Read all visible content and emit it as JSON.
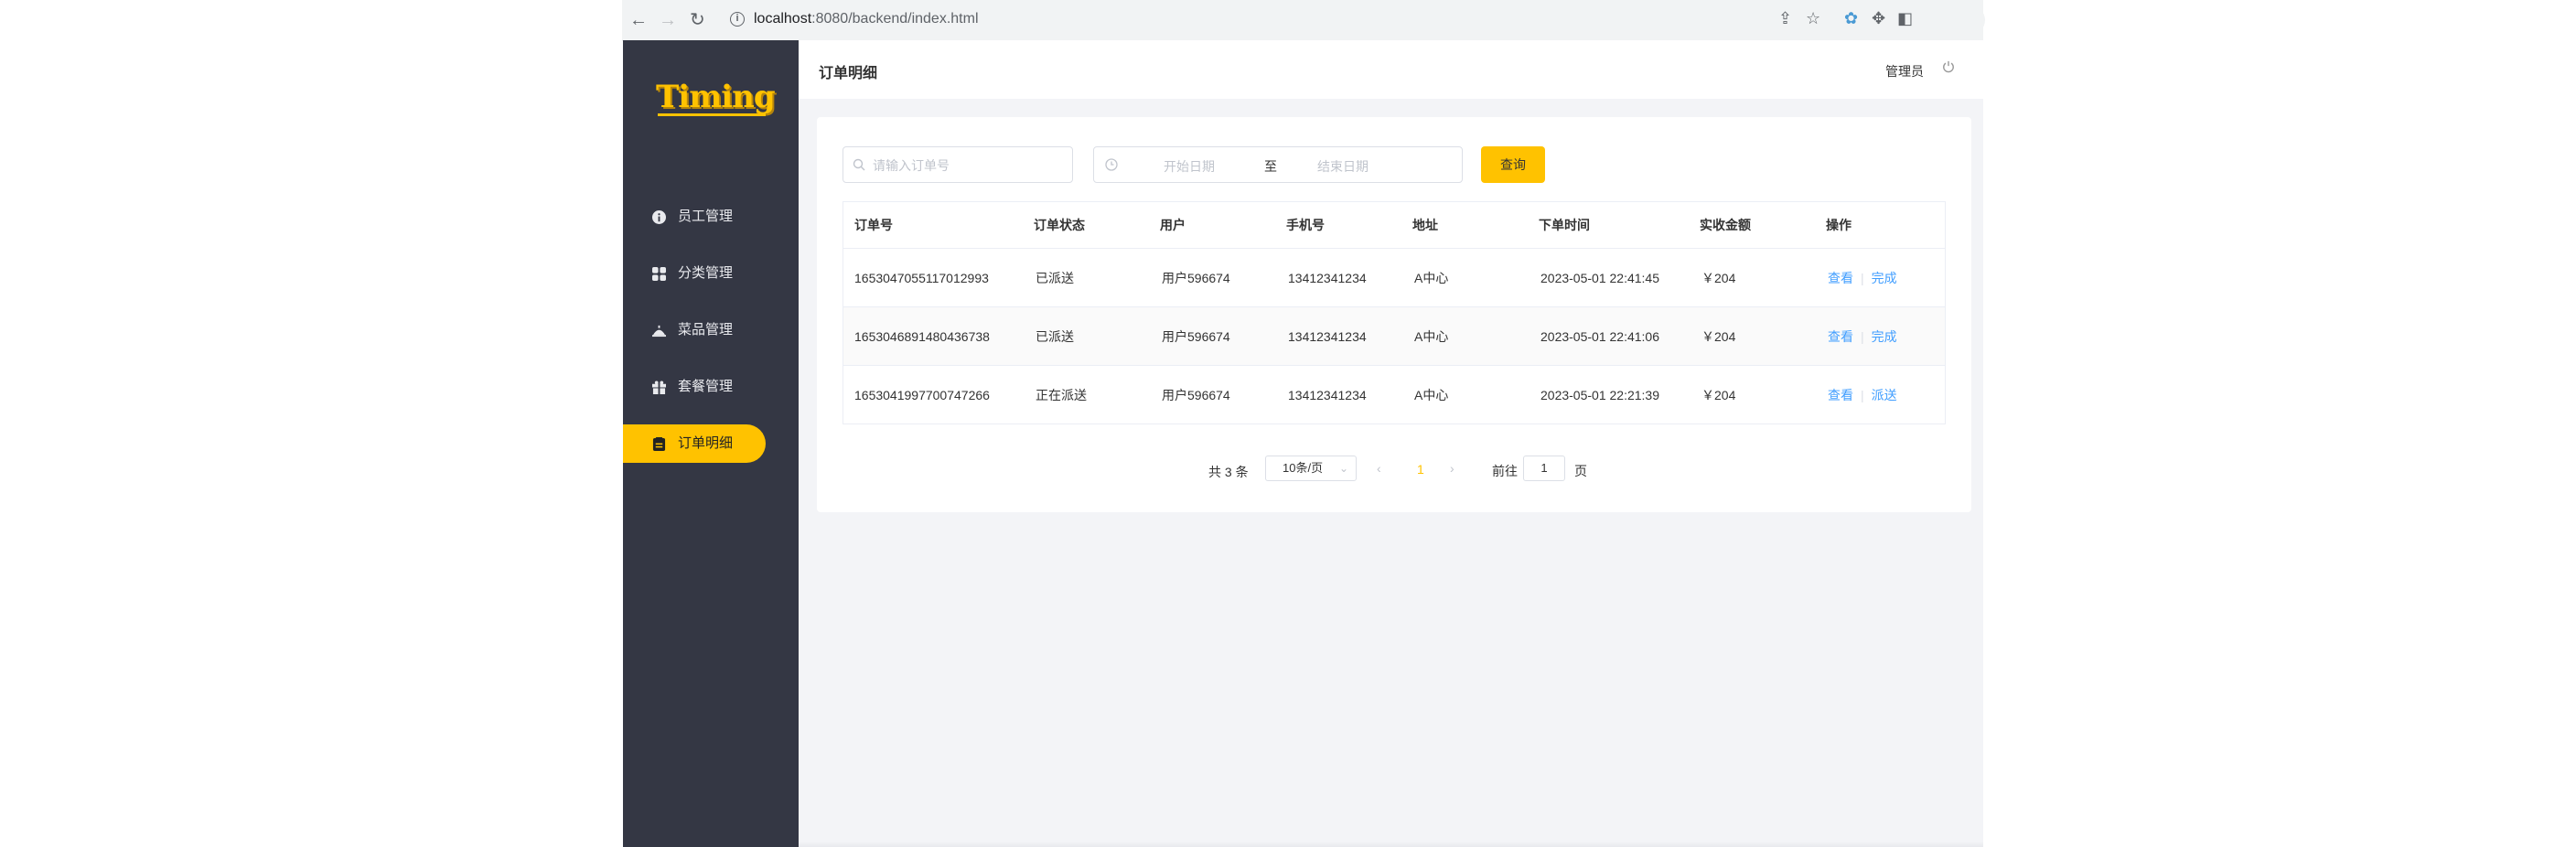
{
  "browser": {
    "url_host": "localhost",
    "url_path": ":8080/backend/index.html"
  },
  "sidebar": {
    "logo": "Timing",
    "items": [
      {
        "label": "员工管理",
        "icon": "info-icon"
      },
      {
        "label": "分类管理",
        "icon": "grid-icon"
      },
      {
        "label": "菜品管理",
        "icon": "dish-icon"
      },
      {
        "label": "套餐管理",
        "icon": "gift-icon"
      },
      {
        "label": "订单明细",
        "icon": "order-icon",
        "active": true
      }
    ],
    "accent": "#ffc200",
    "background": "#343744"
  },
  "header": {
    "title": "订单明细",
    "user": "管理员"
  },
  "filters": {
    "order_placeholder": "请输入订单号",
    "start_placeholder": "开始日期",
    "separator": "至",
    "end_placeholder": "结束日期",
    "query_label": "查询"
  },
  "table": {
    "headers": [
      "订单号",
      "订单状态",
      "用户",
      "手机号",
      "地址",
      "下单时间",
      "实收金额",
      "操作"
    ],
    "rows": [
      {
        "id": "1653047055117012993",
        "status": "已派送",
        "user": "用户596674",
        "phone": "13412341234",
        "address": "A中心",
        "time": "2023-05-01 22:41:45",
        "amount": "￥204",
        "action1": "查看",
        "action2": "完成"
      },
      {
        "id": "1653046891480436738",
        "status": "已派送",
        "user": "用户596674",
        "phone": "13412341234",
        "address": "A中心",
        "time": "2023-05-01 22:41:06",
        "amount": "￥204",
        "action1": "查看",
        "action2": "完成"
      },
      {
        "id": "1653041997700747266",
        "status": "正在派送",
        "user": "用户596674",
        "phone": "13412341234",
        "address": "A中心",
        "time": "2023-05-01 22:21:39",
        "amount": "￥204",
        "action1": "查看",
        "action2": "派送"
      }
    ]
  },
  "pagination": {
    "total": "共 3 条",
    "page_size": "10条/页",
    "current_page": "1",
    "goto_label": "前往",
    "goto_value": "1",
    "page_unit": "页"
  }
}
